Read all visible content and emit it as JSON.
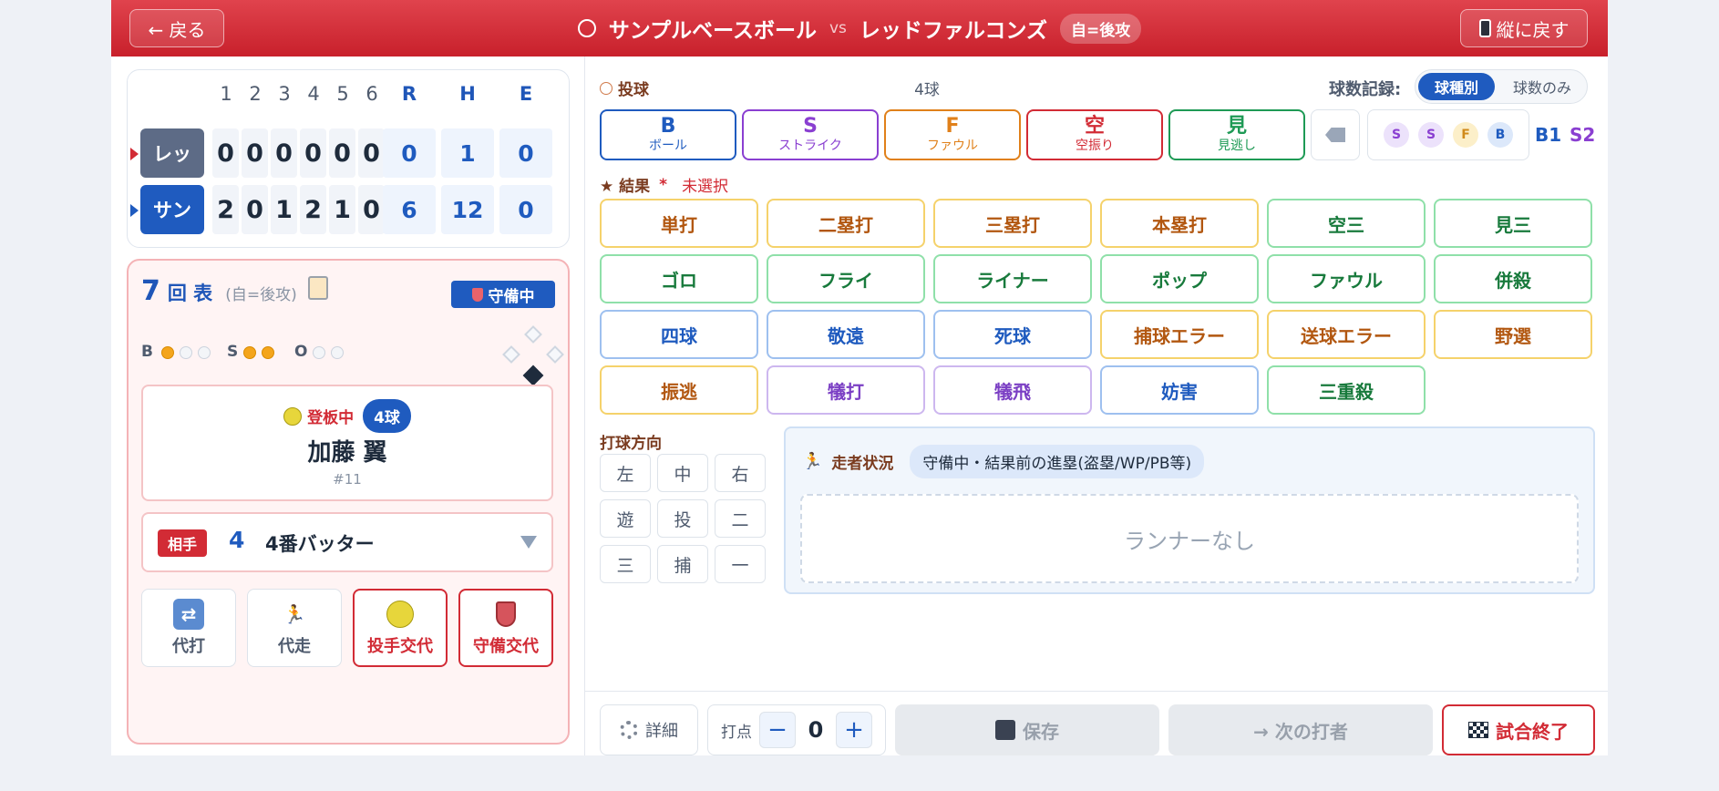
{
  "header": {
    "back_label": "← 戻る",
    "home_team": "サンプルベースボール",
    "vs": "vs",
    "away_team": "レッドファルコンズ",
    "side_badge": "自=後攻",
    "rotate_label": "縦に戻す",
    "ball_icon": "baseball-icon",
    "phone_icon": "phone-icon"
  },
  "scoreboard": {
    "innings": [
      "1",
      "2",
      "3",
      "4",
      "5",
      "6"
    ],
    "totals_headers": [
      "R",
      "H",
      "E"
    ],
    "teams": [
      {
        "short": "レッ",
        "color": "#5d6b86",
        "arrow_color": "#d22b35",
        "scores": [
          "0",
          "0",
          "0",
          "0",
          "0",
          "0"
        ],
        "totals": [
          "0",
          "1",
          "0"
        ]
      },
      {
        "short": "サン",
        "color": "#1f5bbf",
        "arrow_color": "#1f5bbf",
        "scores": [
          "2",
          "0",
          "1",
          "2",
          "1",
          "0"
        ],
        "totals": [
          "6",
          "12",
          "0"
        ]
      }
    ]
  },
  "game": {
    "inning_num": "7",
    "inning_half": "回 表",
    "inning_sub": "(自=後攻)",
    "defense_badge": "守備中",
    "count_labels": [
      "B",
      "S",
      "O"
    ],
    "balls": 1,
    "strikes": 2,
    "outs": 0,
    "pitcher": {
      "status": "登板中",
      "pitch_count": "4球",
      "name": "加藤 翼",
      "number": "#11"
    },
    "batter": {
      "tag": "相手",
      "order": "4",
      "name": "4番バッター"
    },
    "sub_buttons": [
      {
        "label": "代打",
        "icon": "swap-icon"
      },
      {
        "label": "代走",
        "icon": "runner-icon"
      },
      {
        "label": "投手交代",
        "icon": "softball-icon"
      },
      {
        "label": "守備交代",
        "icon": "shield-icon"
      }
    ]
  },
  "pitch": {
    "section_label": "投球",
    "pitch_total": "4球",
    "record_label": "球数記録:",
    "record_options": [
      "球種別",
      "球数のみ"
    ],
    "buttons": [
      {
        "key": "B",
        "sub": "ボール",
        "color": "#1f5bbf"
      },
      {
        "key": "S",
        "sub": "ストライク",
        "color": "#8a3fd1"
      },
      {
        "key": "F",
        "sub": "ファウル",
        "color": "#e0801a"
      },
      {
        "key": "空",
        "sub": "空振り",
        "color": "#d22b35"
      },
      {
        "key": "見",
        "sub": "見逃し",
        "color": "#1e9a55"
      }
    ],
    "history": [
      "S",
      "S",
      "F",
      "B"
    ],
    "summary_b": "B1",
    "summary_s": "S2"
  },
  "result": {
    "label": "★ 結果",
    "required": "*",
    "status": "未選択",
    "rows": [
      [
        {
          "t": "単打",
          "c": "yellow"
        },
        {
          "t": "二塁打",
          "c": "yellow"
        },
        {
          "t": "三塁打",
          "c": "yellow"
        },
        {
          "t": "本塁打",
          "c": "yellow"
        },
        {
          "t": "空三",
          "c": "green"
        },
        {
          "t": "見三",
          "c": "green"
        }
      ],
      [
        {
          "t": "ゴロ",
          "c": "green"
        },
        {
          "t": "フライ",
          "c": "green"
        },
        {
          "t": "ライナー",
          "c": "green"
        },
        {
          "t": "ポップ",
          "c": "green"
        },
        {
          "t": "ファウル",
          "c": "green"
        },
        {
          "t": "併殺",
          "c": "green"
        }
      ],
      [
        {
          "t": "四球",
          "c": "blue"
        },
        {
          "t": "敬遠",
          "c": "blue"
        },
        {
          "t": "死球",
          "c": "blue"
        },
        {
          "t": "捕球エラー",
          "c": "yellow"
        },
        {
          "t": "送球エラー",
          "c": "yellow"
        },
        {
          "t": "野選",
          "c": "yellow"
        }
      ],
      [
        {
          "t": "振逃",
          "c": "yellow"
        },
        {
          "t": "犠打",
          "c": "purple"
        },
        {
          "t": "犠飛",
          "c": "purple"
        },
        {
          "t": "妨害",
          "c": "blue"
        },
        {
          "t": "三重殺",
          "c": "green"
        }
      ]
    ]
  },
  "direction": {
    "label": "打球方向",
    "grid": [
      [
        "左",
        "中",
        "右"
      ],
      [
        "遊",
        "投",
        "二"
      ],
      [
        "三",
        "捕",
        "一"
      ]
    ]
  },
  "runners": {
    "label": "走者状況",
    "chip": "守備中・結果前の進塁(盗塁/WP/PB等)",
    "empty": "ランナーなし"
  },
  "footer": {
    "detail": "詳細",
    "rbi_label": "打点",
    "rbi_value": "0",
    "minus": "−",
    "plus": "+",
    "save": "保存",
    "next": "→ 次の打者",
    "end": "試合終了"
  }
}
